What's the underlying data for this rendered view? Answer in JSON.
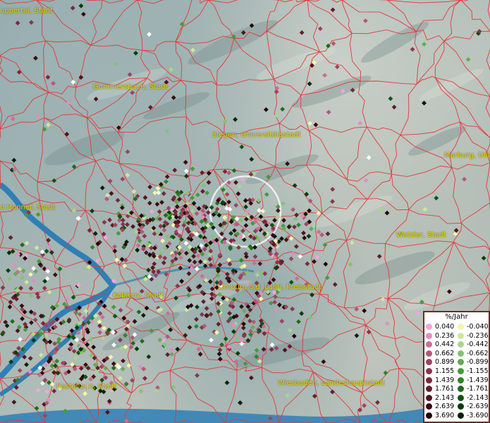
{
  "map": {
    "places": [
      {
        "id": "wuppertal",
        "label": "uppertal, Stadt"
      },
      {
        "id": "gummersbach",
        "label": "Gummersbach, Stadt"
      },
      {
        "id": "siegen",
        "label": "Siegen, Universitätsstadt"
      },
      {
        "id": "marburg",
        "label": "Marburg, Univ"
      },
      {
        "id": "honnef",
        "label": "d Honnef, Stadt"
      },
      {
        "id": "wetzlar",
        "label": "Wetzlar, Stadt"
      },
      {
        "id": "limburg",
        "label": "Limburg a.d. Lahn, Kreisstadt"
      },
      {
        "id": "koblenz",
        "label": "Koblenz, Stadt"
      },
      {
        "id": "kastellaun",
        "label": "Kastellaun, Stadt"
      },
      {
        "id": "wiesbaden",
        "label": "Wiesbaden, Landeshauptstadt"
      }
    ],
    "colors": {
      "water": "#2f7fb6",
      "border": "#e23a3a",
      "label": "#e6d000"
    }
  },
  "legend": {
    "title": "%/Jahr",
    "positive": [
      {
        "value": "0.040",
        "color": "#f2a6dc"
      },
      {
        "value": "0.236",
        "color": "#de8fbf"
      },
      {
        "value": "0.442",
        "color": "#c87096"
      },
      {
        "value": "0.662",
        "color": "#b5577b"
      },
      {
        "value": "0.899",
        "color": "#9c4462"
      },
      {
        "value": "1.155",
        "color": "#88364d"
      },
      {
        "value": "1.439",
        "color": "#762a3a"
      },
      {
        "value": "1.761",
        "color": "#631f2c"
      },
      {
        "value": "2.143",
        "color": "#4e141d"
      },
      {
        "value": "2.639",
        "color": "#370b12"
      },
      {
        "value": "3.690",
        "color": "#1f0408"
      }
    ],
    "negative": [
      {
        "value": "-0.040",
        "color": "#f2f7a8"
      },
      {
        "value": "-0.236",
        "color": "#cfe69d"
      },
      {
        "value": "-0.442",
        "color": "#a8d58c"
      },
      {
        "value": "-0.662",
        "color": "#85c36f"
      },
      {
        "value": "-0.899",
        "color": "#63ad52"
      },
      {
        "value": "-1.155",
        "color": "#479a3c"
      },
      {
        "value": "-1.439",
        "color": "#2f852a"
      },
      {
        "value": "-1.761",
        "color": "#1d6d1c"
      },
      {
        "value": "-2.143",
        "color": "#105512"
      },
      {
        "value": "-2.639",
        "color": "#073d0a"
      },
      {
        "value": "-3.690",
        "color": "#022405"
      }
    ]
  }
}
